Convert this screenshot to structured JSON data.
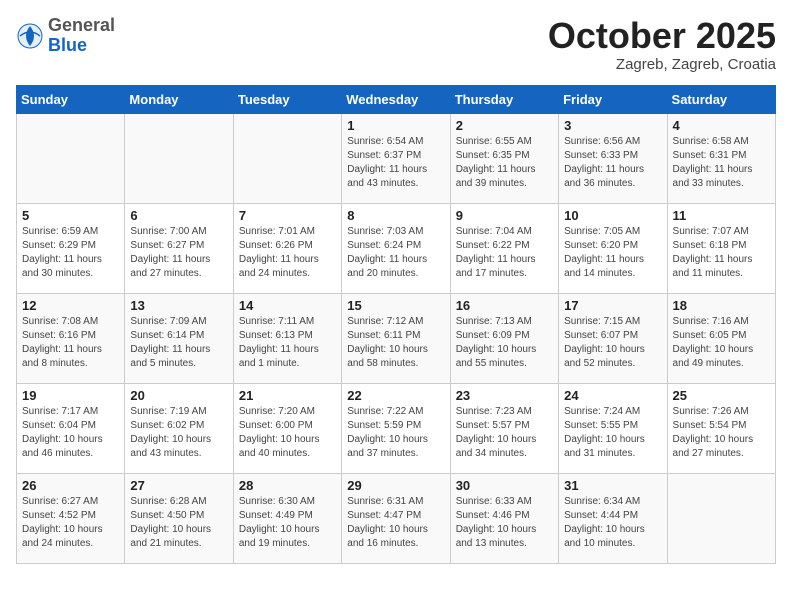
{
  "header": {
    "logo_general": "General",
    "logo_blue": "Blue",
    "month_title": "October 2025",
    "location": "Zagreb, Zagreb, Croatia"
  },
  "days_of_week": [
    "Sunday",
    "Monday",
    "Tuesday",
    "Wednesday",
    "Thursday",
    "Friday",
    "Saturday"
  ],
  "weeks": [
    [
      {
        "day": "",
        "info": ""
      },
      {
        "day": "",
        "info": ""
      },
      {
        "day": "",
        "info": ""
      },
      {
        "day": "1",
        "info": "Sunrise: 6:54 AM\nSunset: 6:37 PM\nDaylight: 11 hours\nand 43 minutes."
      },
      {
        "day": "2",
        "info": "Sunrise: 6:55 AM\nSunset: 6:35 PM\nDaylight: 11 hours\nand 39 minutes."
      },
      {
        "day": "3",
        "info": "Sunrise: 6:56 AM\nSunset: 6:33 PM\nDaylight: 11 hours\nand 36 minutes."
      },
      {
        "day": "4",
        "info": "Sunrise: 6:58 AM\nSunset: 6:31 PM\nDaylight: 11 hours\nand 33 minutes."
      }
    ],
    [
      {
        "day": "5",
        "info": "Sunrise: 6:59 AM\nSunset: 6:29 PM\nDaylight: 11 hours\nand 30 minutes."
      },
      {
        "day": "6",
        "info": "Sunrise: 7:00 AM\nSunset: 6:27 PM\nDaylight: 11 hours\nand 27 minutes."
      },
      {
        "day": "7",
        "info": "Sunrise: 7:01 AM\nSunset: 6:26 PM\nDaylight: 11 hours\nand 24 minutes."
      },
      {
        "day": "8",
        "info": "Sunrise: 7:03 AM\nSunset: 6:24 PM\nDaylight: 11 hours\nand 20 minutes."
      },
      {
        "day": "9",
        "info": "Sunrise: 7:04 AM\nSunset: 6:22 PM\nDaylight: 11 hours\nand 17 minutes."
      },
      {
        "day": "10",
        "info": "Sunrise: 7:05 AM\nSunset: 6:20 PM\nDaylight: 11 hours\nand 14 minutes."
      },
      {
        "day": "11",
        "info": "Sunrise: 7:07 AM\nSunset: 6:18 PM\nDaylight: 11 hours\nand 11 minutes."
      }
    ],
    [
      {
        "day": "12",
        "info": "Sunrise: 7:08 AM\nSunset: 6:16 PM\nDaylight: 11 hours\nand 8 minutes."
      },
      {
        "day": "13",
        "info": "Sunrise: 7:09 AM\nSunset: 6:14 PM\nDaylight: 11 hours\nand 5 minutes."
      },
      {
        "day": "14",
        "info": "Sunrise: 7:11 AM\nSunset: 6:13 PM\nDaylight: 11 hours\nand 1 minute."
      },
      {
        "day": "15",
        "info": "Sunrise: 7:12 AM\nSunset: 6:11 PM\nDaylight: 10 hours\nand 58 minutes."
      },
      {
        "day": "16",
        "info": "Sunrise: 7:13 AM\nSunset: 6:09 PM\nDaylight: 10 hours\nand 55 minutes."
      },
      {
        "day": "17",
        "info": "Sunrise: 7:15 AM\nSunset: 6:07 PM\nDaylight: 10 hours\nand 52 minutes."
      },
      {
        "day": "18",
        "info": "Sunrise: 7:16 AM\nSunset: 6:05 PM\nDaylight: 10 hours\nand 49 minutes."
      }
    ],
    [
      {
        "day": "19",
        "info": "Sunrise: 7:17 AM\nSunset: 6:04 PM\nDaylight: 10 hours\nand 46 minutes."
      },
      {
        "day": "20",
        "info": "Sunrise: 7:19 AM\nSunset: 6:02 PM\nDaylight: 10 hours\nand 43 minutes."
      },
      {
        "day": "21",
        "info": "Sunrise: 7:20 AM\nSunset: 6:00 PM\nDaylight: 10 hours\nand 40 minutes."
      },
      {
        "day": "22",
        "info": "Sunrise: 7:22 AM\nSunset: 5:59 PM\nDaylight: 10 hours\nand 37 minutes."
      },
      {
        "day": "23",
        "info": "Sunrise: 7:23 AM\nSunset: 5:57 PM\nDaylight: 10 hours\nand 34 minutes."
      },
      {
        "day": "24",
        "info": "Sunrise: 7:24 AM\nSunset: 5:55 PM\nDaylight: 10 hours\nand 31 minutes."
      },
      {
        "day": "25",
        "info": "Sunrise: 7:26 AM\nSunset: 5:54 PM\nDaylight: 10 hours\nand 27 minutes."
      }
    ],
    [
      {
        "day": "26",
        "info": "Sunrise: 6:27 AM\nSunset: 4:52 PM\nDaylight: 10 hours\nand 24 minutes."
      },
      {
        "day": "27",
        "info": "Sunrise: 6:28 AM\nSunset: 4:50 PM\nDaylight: 10 hours\nand 21 minutes."
      },
      {
        "day": "28",
        "info": "Sunrise: 6:30 AM\nSunset: 4:49 PM\nDaylight: 10 hours\nand 19 minutes."
      },
      {
        "day": "29",
        "info": "Sunrise: 6:31 AM\nSunset: 4:47 PM\nDaylight: 10 hours\nand 16 minutes."
      },
      {
        "day": "30",
        "info": "Sunrise: 6:33 AM\nSunset: 4:46 PM\nDaylight: 10 hours\nand 13 minutes."
      },
      {
        "day": "31",
        "info": "Sunrise: 6:34 AM\nSunset: 4:44 PM\nDaylight: 10 hours\nand 10 minutes."
      },
      {
        "day": "",
        "info": ""
      }
    ]
  ]
}
